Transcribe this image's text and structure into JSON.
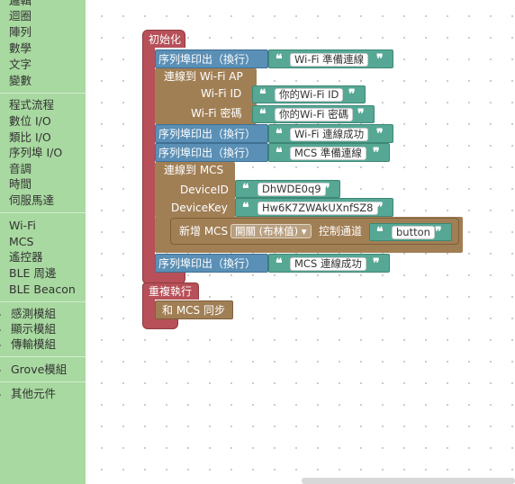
{
  "sidebar": {
    "items": [
      "邏輯",
      "迴圈",
      "陣列",
      "數學",
      "文字",
      "變數",
      "程式流程",
      "數位 I/O",
      "類比 I/O",
      "序列埠 I/O",
      "音調",
      "時間",
      "伺服馬達",
      "Wi-Fi",
      "MCS",
      "遙控器",
      "BLE 周邊",
      "BLE Beacon"
    ],
    "categories": [
      "感測模組",
      "顯示模組",
      "傳輸模組",
      "Grove模組",
      "其他元件"
    ]
  },
  "blocks": {
    "init_label": "初始化",
    "serial_println": "序列埠印出（換行）",
    "wifi_ready": "Wi-Fi 準備連線",
    "wifi_connect": "連線到 Wi-Fi AP",
    "wifi_id_label": "Wi-Fi ID",
    "wifi_id_value": "你的Wi-Fi ID",
    "wifi_pw_label": "Wi-Fi 密碼",
    "wifi_pw_value": "你的Wi-Fi 密碼",
    "wifi_success": "Wi-Fi 連線成功",
    "mcs_ready": "MCS 準備連線",
    "mcs_connect": "連線到 MCS",
    "device_id_label": "DeviceID",
    "device_id_value": "DhWDE0q9",
    "device_key_label": "DeviceKey",
    "device_key_value": "Hw6K7ZWAkUXnfSZ8",
    "add_mcs": "新增 MCS",
    "switch_type": "開關 (布林值)",
    "control_channel": "控制通道",
    "channel_value": "button",
    "mcs_success": "MCS 連線成功",
    "loop_label": "重複執行",
    "sync_label": "和 MCS 同步",
    "quote_open": "❝",
    "quote_close": "❞"
  }
}
